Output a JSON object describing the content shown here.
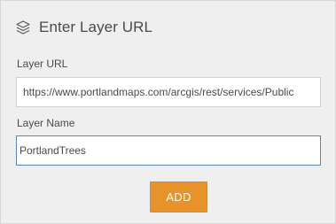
{
  "panel": {
    "title": "Enter Layer URL",
    "title_icon": "layers-icon"
  },
  "fields": {
    "layer_url": {
      "label": "Layer URL",
      "value": "https://www.portlandmaps.com/arcgis/rest/services/Public"
    },
    "layer_name": {
      "label": "Layer Name",
      "value": "PortlandTrees"
    }
  },
  "actions": {
    "add_label": "ADD"
  },
  "colors": {
    "panel_background": "#efefef",
    "add_button": "#e8932a",
    "focused_border": "#5b87b8",
    "text": "#4a4a4a"
  }
}
